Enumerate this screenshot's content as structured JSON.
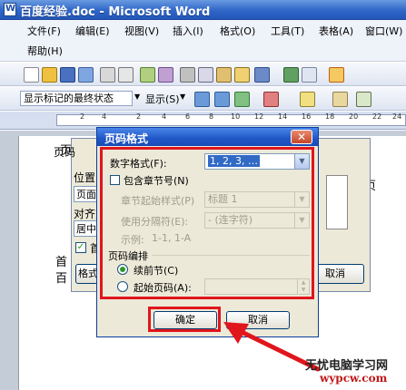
{
  "window": {
    "title": "百度经验.doc - Microsoft Word"
  },
  "menubar": {
    "row1": [
      {
        "label": "文件(F)"
      },
      {
        "label": "编辑(E)"
      },
      {
        "label": "视图(V)"
      },
      {
        "label": "插入(I)"
      },
      {
        "label": "格式(O)"
      },
      {
        "label": "工具(T)"
      },
      {
        "label": "表格(A)"
      },
      {
        "label": "窗口(W)"
      }
    ],
    "row2": [
      {
        "label": "帮助(H)"
      }
    ]
  },
  "toolbar2": {
    "markup_combo": "显示标记的最终状态",
    "show_button": "显示(S)"
  },
  "ruler": {
    "numbers": [
      "2",
      "4",
      "2",
      "4",
      "6",
      "8",
      "10",
      "12",
      "14",
      "16",
      "18",
      "20",
      "22",
      "24"
    ]
  },
  "background_dialog": {
    "title": "页码",
    "position_label": "位置(",
    "position_value": "页面顶",
    "align_label": "对齐方",
    "align_value": "居中",
    "first_page_label": "首页",
    "format_button": "格式",
    "cancel_button": "取消"
  },
  "document": {
    "text_fragments": [
      "页",
      "页",
      "首",
      "百"
    ]
  },
  "dialog": {
    "title": "页码格式",
    "number_format_label": "数字格式(F):",
    "number_format_value": "1, 2, 3, …",
    "include_chapter_label": "包含章节号(N)",
    "chapter_style_label": "章节起始样式(P)",
    "chapter_style_value": "标题 1",
    "separator_label": "使用分隔符(E):",
    "separator_value": "-  (连字符)",
    "example_label": "示例:",
    "example_value": "1-1, 1-A",
    "numbering_group": "页码编排",
    "continue_option": "续前节(C)",
    "start_at_option": "起始页码(A):",
    "ok_button": "确定",
    "cancel_button": "取消"
  },
  "watermark": {
    "line1": "无忧电脑学习网",
    "line2": "wypcw.com"
  },
  "colors": {
    "highlight": "#e0161c",
    "title_blue": "#1f56c6",
    "dialog_bg": "#ece9d8"
  }
}
